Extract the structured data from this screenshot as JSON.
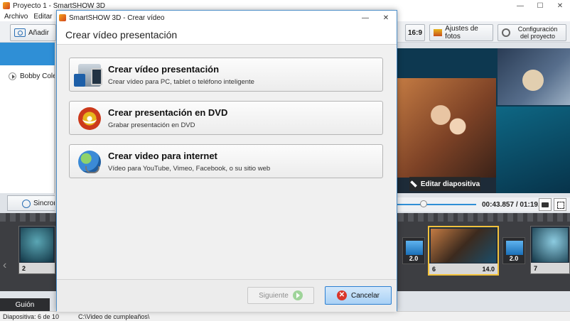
{
  "main_window": {
    "title": "Proyecto 1 - SmartSHOW 3D",
    "controls": [
      "—",
      "☐",
      "✕"
    ],
    "menu": [
      "Archivo",
      "Editar",
      "Pr"
    ],
    "toolbar": {
      "add_label": "Añadir",
      "aspect_label": "16:9",
      "photo_settings_label": "Ajustes de fotos",
      "project_config_label": "Configuración del proyecto"
    },
    "left_list": {
      "item_label": "Bobby Cole -"
    },
    "sync_label": "Sincroni",
    "preview": {
      "edit_slide_label": "Editar diapositiva"
    },
    "transport": {
      "time": "00:43.857 / 01:19.000"
    },
    "timeline": {
      "slides": [
        {
          "number": "2",
          "duration": ""
        },
        {
          "number": "6",
          "duration": "14.0"
        },
        {
          "number": "7",
          "duration": ""
        }
      ],
      "transitions": [
        "2.0",
        "2.0"
      ],
      "nav_left": "‹",
      "nav_right": "›"
    },
    "guion_label": "Guión",
    "status": {
      "slide_info": "Diapositiva: 6 de 10",
      "path": "C:\\Video de cumpleaños\\"
    }
  },
  "dialog": {
    "title": "SmartSHOW 3D - Crear vídeo",
    "close": "✕",
    "minimize": "—",
    "header": "Crear vídeo presentación",
    "options": [
      {
        "title": "Crear vídeo presentación",
        "subtitle": "Crear vídeo para PC, tablet o teléfono inteligente",
        "icon": "pc-device-icon"
      },
      {
        "title": "Crear presentación en DVD",
        "subtitle": "Grabar presentación en DVD",
        "icon": "dvd-icon"
      },
      {
        "title": "Crear video para internet",
        "subtitle": "Vídeo para YouTube, Vimeo, Facebook, o su sitio web",
        "icon": "globe-icon"
      }
    ],
    "next_label": "Siguiente",
    "cancel_label": "Cancelar"
  }
}
